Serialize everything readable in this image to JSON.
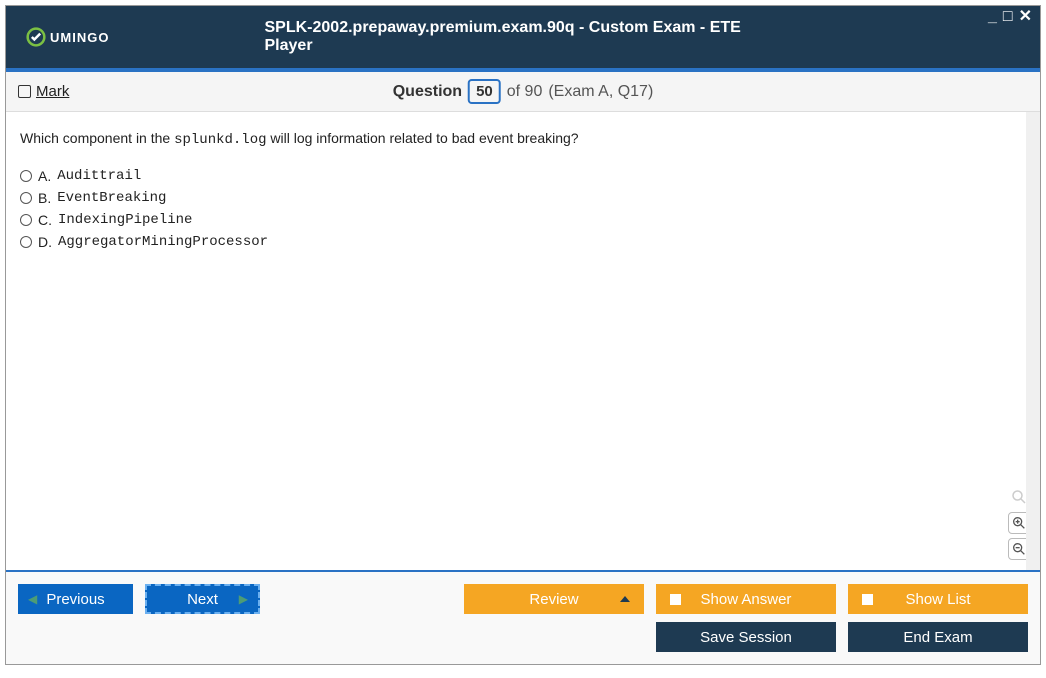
{
  "header": {
    "logo_text": "UMINGO",
    "title": "SPLK-2002.prepaway.premium.exam.90q - Custom Exam - ETE Player"
  },
  "qbar": {
    "mark_label": "Mark",
    "question_label": "Question",
    "current": "50",
    "of_label": "of 90",
    "context": "(Exam A, Q17)"
  },
  "question": {
    "prefix": "Which component in the ",
    "code": "splunkd.log",
    "suffix": " will log information related to bad event breaking?"
  },
  "options": [
    {
      "letter": "A.",
      "text": "Audittrail"
    },
    {
      "letter": "B.",
      "text": "EventBreaking"
    },
    {
      "letter": "C.",
      "text": "IndexingPipeline"
    },
    {
      "letter": "D.",
      "text": "AggregatorMiningProcessor"
    }
  ],
  "footer": {
    "previous": "Previous",
    "next": "Next",
    "review": "Review",
    "show_answer": "Show Answer",
    "show_list": "Show List",
    "save_session": "Save Session",
    "end_exam": "End Exam"
  }
}
